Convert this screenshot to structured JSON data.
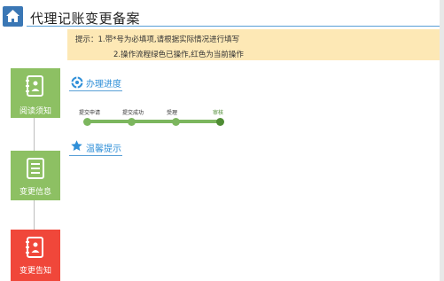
{
  "header": {
    "title": "代理记账变更备案",
    "home_icon": "home-icon"
  },
  "tip": {
    "line1": "提示：1.带*号为必填项,请根据实际情况进行填写",
    "line2": "2.操作流程绿色已操作,红色为当前操作"
  },
  "sidebar": {
    "steps": [
      {
        "label": "阅读须知",
        "icon": "notebook-icon",
        "color": "#8dc063",
        "status": "done"
      },
      {
        "label": "变更信息",
        "icon": "document-icon",
        "color": "#8dc063",
        "status": "done"
      },
      {
        "label": "变更告知",
        "icon": "notebook-icon",
        "color": "#f0473a",
        "status": "current"
      }
    ]
  },
  "progress": {
    "title": "办理进度",
    "nodes": [
      {
        "label": "提交申请",
        "status": "done"
      },
      {
        "label": "提交成功",
        "status": "done"
      },
      {
        "label": "受理",
        "status": "done"
      },
      {
        "label": "审核",
        "status": "current"
      }
    ]
  },
  "notice": {
    "title": "温馨提示"
  },
  "colors": {
    "accent_blue": "#2f8fd8",
    "green": "#8dc063",
    "red": "#f0473a",
    "tip_bg": "#fde8b5"
  }
}
